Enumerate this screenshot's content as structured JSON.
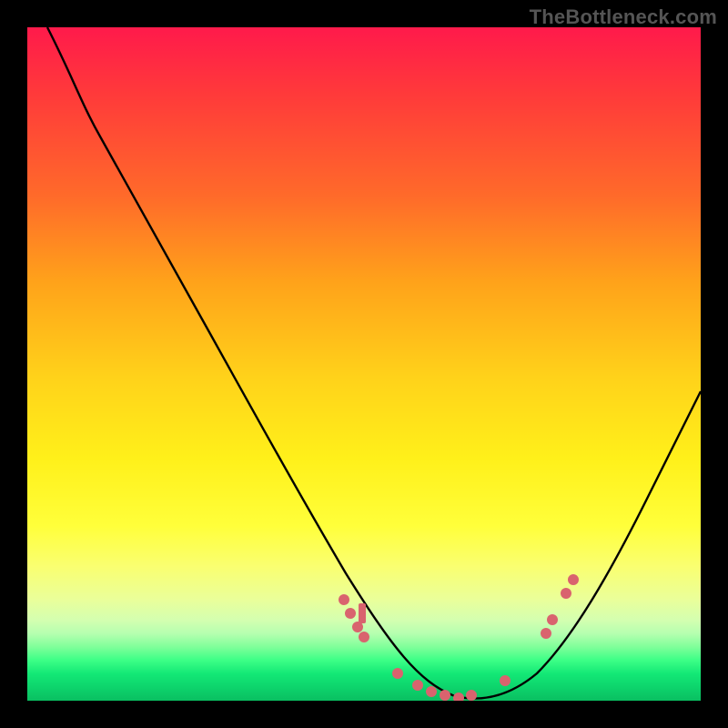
{
  "attribution": "TheBottleneck.com",
  "chart_data": {
    "type": "line",
    "title": "",
    "xlabel": "",
    "ylabel": "",
    "xlim": [
      0,
      100
    ],
    "ylim": [
      0,
      100
    ],
    "grid": false,
    "legend": false,
    "gradient_bands": [
      {
        "name": "red",
        "y_pct": 0
      },
      {
        "name": "orange",
        "y_pct": 38
      },
      {
        "name": "yellow",
        "y_pct": 70
      },
      {
        "name": "green",
        "y_pct": 95
      }
    ],
    "series": [
      {
        "name": "bottleneck-curve",
        "color": "#000000",
        "points": [
          {
            "x": 3,
            "y": 100
          },
          {
            "x": 6,
            "y": 95
          },
          {
            "x": 10,
            "y": 88
          },
          {
            "x": 15,
            "y": 78
          },
          {
            "x": 20,
            "y": 68
          },
          {
            "x": 25,
            "y": 58
          },
          {
            "x": 30,
            "y": 48
          },
          {
            "x": 35,
            "y": 38
          },
          {
            "x": 40,
            "y": 28
          },
          {
            "x": 45,
            "y": 18
          },
          {
            "x": 50,
            "y": 10
          },
          {
            "x": 55,
            "y": 4
          },
          {
            "x": 60,
            "y": 1
          },
          {
            "x": 65,
            "y": 0
          },
          {
            "x": 70,
            "y": 2
          },
          {
            "x": 75,
            "y": 8
          },
          {
            "x": 80,
            "y": 16
          },
          {
            "x": 85,
            "y": 26
          },
          {
            "x": 90,
            "y": 36
          },
          {
            "x": 95,
            "y": 44
          },
          {
            "x": 100,
            "y": 50
          }
        ]
      }
    ],
    "scatter": {
      "name": "highlighted-points",
      "color": "#d9636e",
      "points": [
        {
          "x": 47,
          "y": 15
        },
        {
          "x": 48,
          "y": 12
        },
        {
          "x": 49,
          "y": 10
        },
        {
          "x": 50,
          "y": 9
        },
        {
          "x": 55,
          "y": 4
        },
        {
          "x": 58,
          "y": 2
        },
        {
          "x": 60,
          "y": 1
        },
        {
          "x": 62,
          "y": 1
        },
        {
          "x": 64,
          "y": 0
        },
        {
          "x": 66,
          "y": 1
        },
        {
          "x": 71,
          "y": 3
        },
        {
          "x": 77,
          "y": 10
        },
        {
          "x": 78,
          "y": 12
        },
        {
          "x": 80,
          "y": 16
        },
        {
          "x": 81,
          "y": 18
        }
      ]
    }
  }
}
